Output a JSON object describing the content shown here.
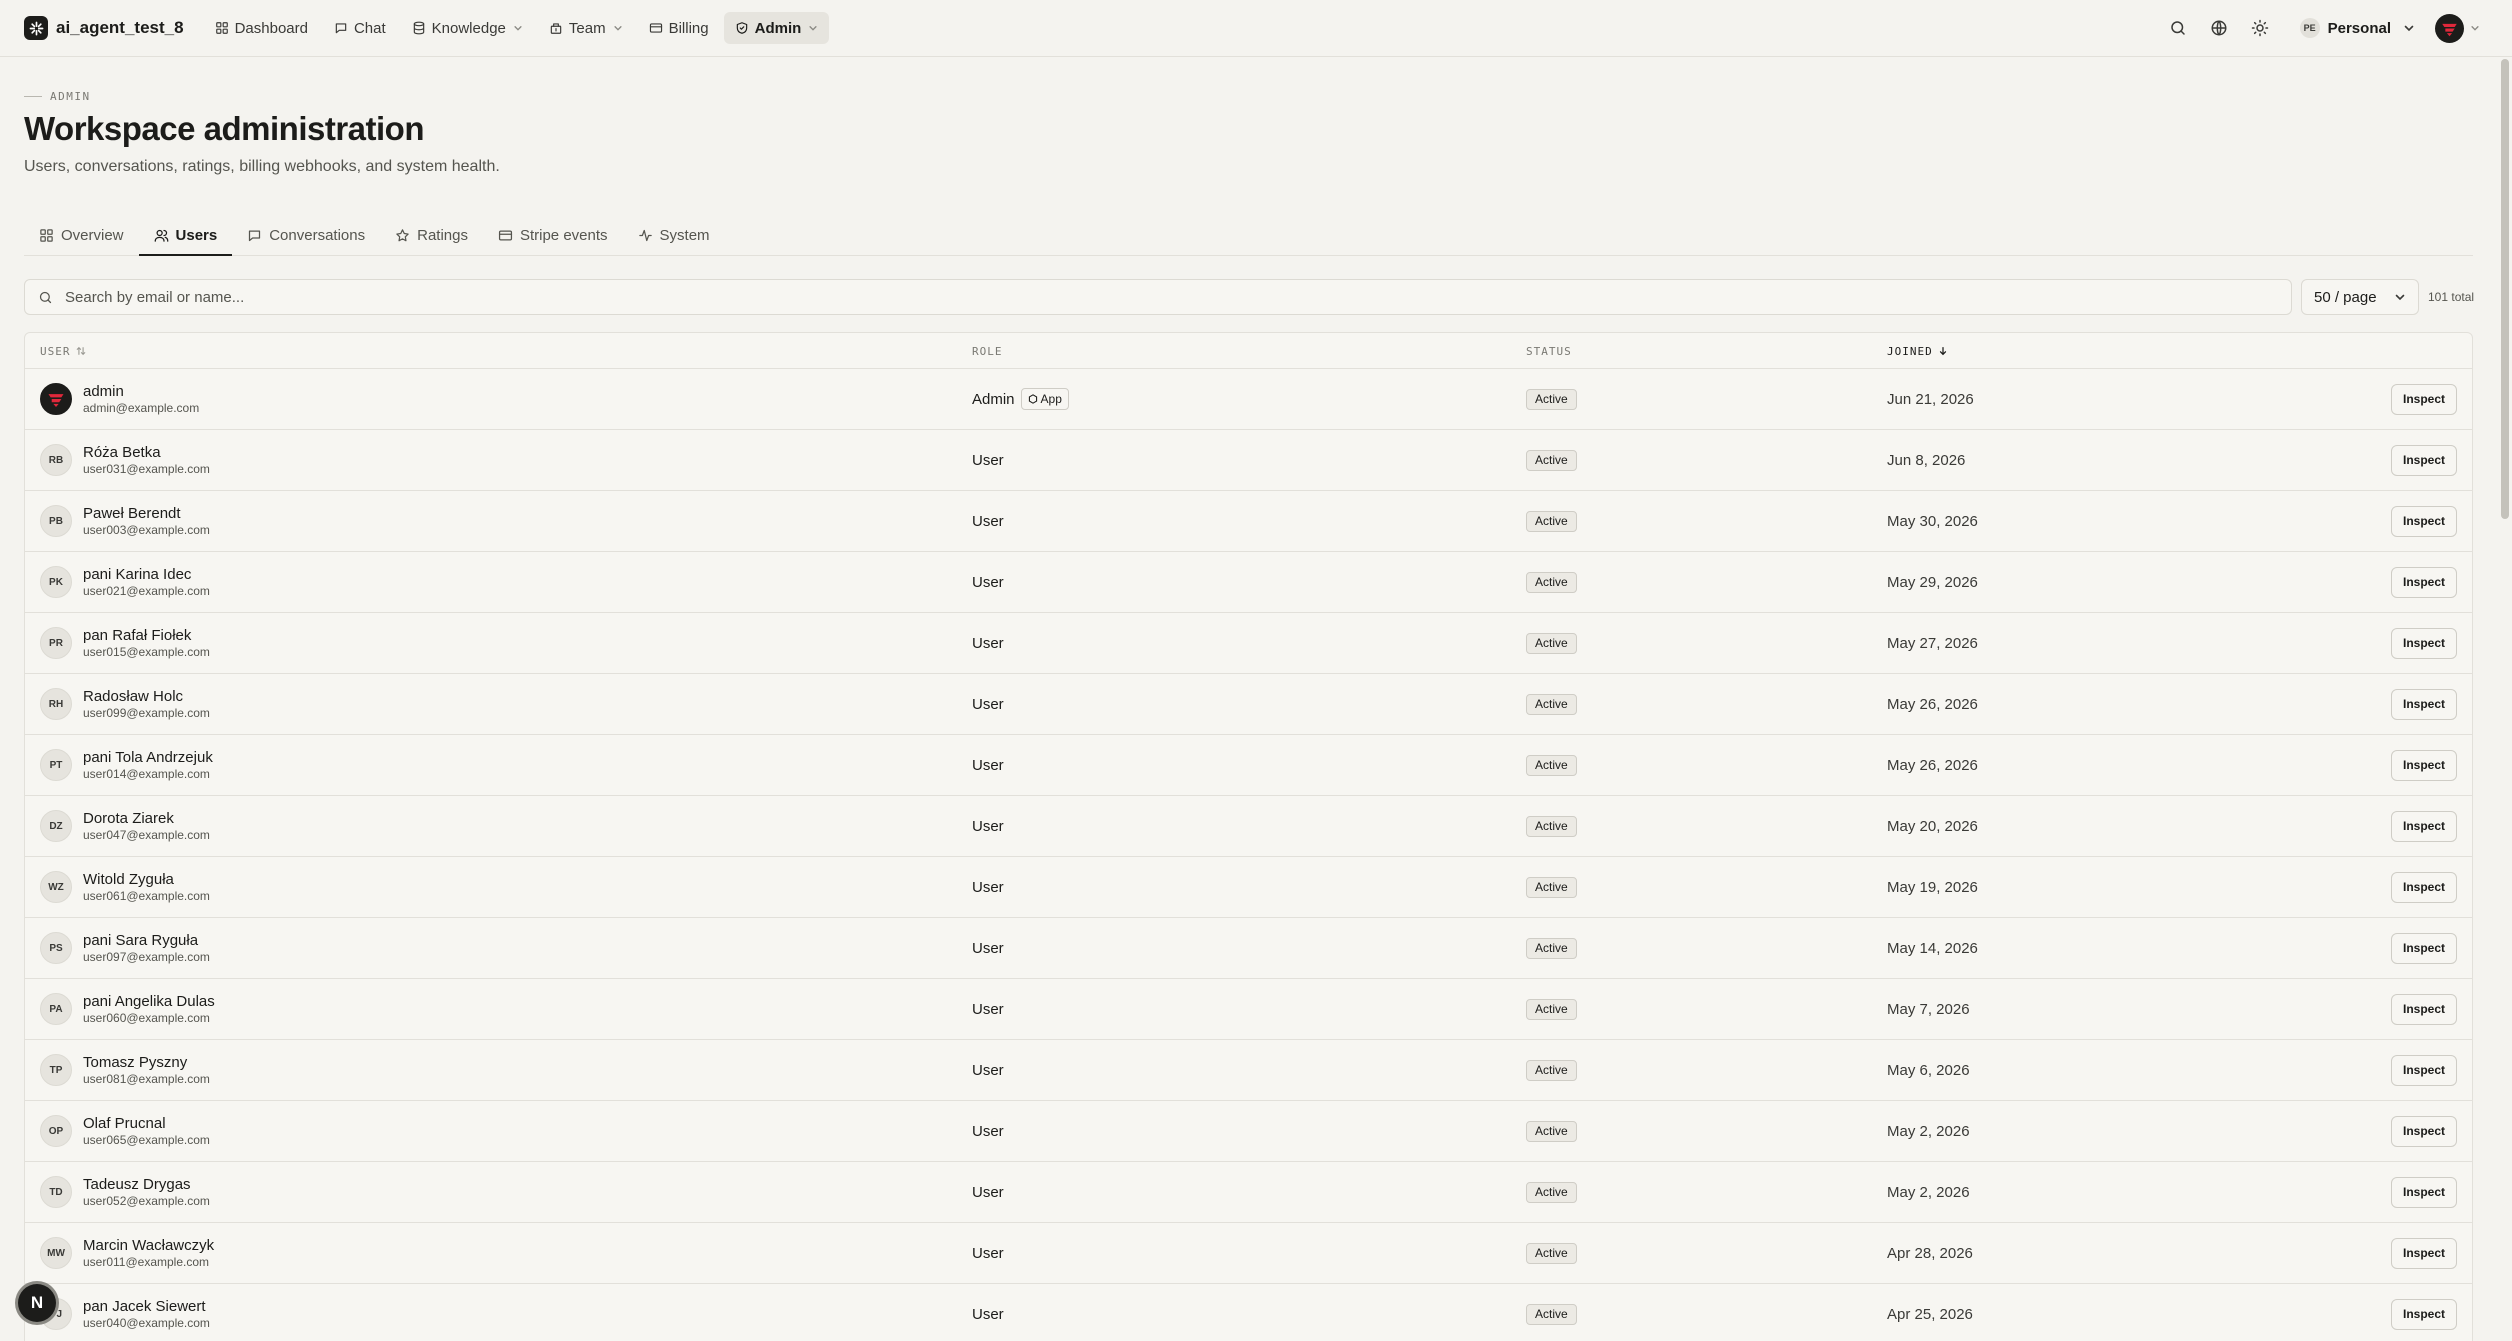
{
  "app": {
    "name": "ai_agent_test_8"
  },
  "nav": {
    "items": [
      {
        "label": "Dashboard",
        "icon": "dashboard-icon",
        "has_menu": false,
        "active": false
      },
      {
        "label": "Chat",
        "icon": "chat-icon",
        "has_menu": false,
        "active": false
      },
      {
        "label": "Knowledge",
        "icon": "database-icon",
        "has_menu": true,
        "active": false
      },
      {
        "label": "Team",
        "icon": "team-icon",
        "has_menu": true,
        "active": false
      },
      {
        "label": "Billing",
        "icon": "card-icon",
        "has_menu": false,
        "active": false
      },
      {
        "label": "Admin",
        "icon": "shield-icon",
        "has_menu": true,
        "active": true
      }
    ]
  },
  "topbar": {
    "workspace_initials": "PE",
    "workspace_name": "Personal"
  },
  "header": {
    "eyebrow": "ADMIN",
    "title": "Workspace administration",
    "subtitle": "Users, conversations, ratings, billing webhooks, and system health."
  },
  "tabs": [
    {
      "label": "Overview",
      "icon": "grid-icon",
      "active": false
    },
    {
      "label": "Users",
      "icon": "users-icon",
      "active": true
    },
    {
      "label": "Conversations",
      "icon": "chat-icon",
      "active": false
    },
    {
      "label": "Ratings",
      "icon": "star-icon",
      "active": false
    },
    {
      "label": "Stripe events",
      "icon": "card-icon",
      "active": false
    },
    {
      "label": "System",
      "icon": "activity-icon",
      "active": false
    }
  ],
  "toolbar": {
    "search_placeholder": "Search by email or name...",
    "per_page": "50 / page",
    "total": "101 total"
  },
  "table": {
    "columns": {
      "user": "USER",
      "role": "ROLE",
      "status": "STATUS",
      "joined": "JOINED"
    },
    "action_label": "Inspect",
    "rows": [
      {
        "initials": "",
        "avatar_image": true,
        "name": "admin",
        "email": "admin@example.com",
        "role": "Admin",
        "role_tag": "App",
        "status": "Active",
        "joined": "Jun 21, 2026"
      },
      {
        "initials": "RB",
        "name": "Róża Betka",
        "email": "user031@example.com",
        "role": "User",
        "status": "Active",
        "joined": "Jun 8, 2026"
      },
      {
        "initials": "PB",
        "name": "Paweł Berendt",
        "email": "user003@example.com",
        "role": "User",
        "status": "Active",
        "joined": "May 30, 2026"
      },
      {
        "initials": "PK",
        "name": "pani Karina Idec",
        "email": "user021@example.com",
        "role": "User",
        "status": "Active",
        "joined": "May 29, 2026"
      },
      {
        "initials": "PR",
        "name": "pan Rafał Fiołek",
        "email": "user015@example.com",
        "role": "User",
        "status": "Active",
        "joined": "May 27, 2026"
      },
      {
        "initials": "RH",
        "name": "Radosław Holc",
        "email": "user099@example.com",
        "role": "User",
        "status": "Active",
        "joined": "May 26, 2026"
      },
      {
        "initials": "PT",
        "name": "pani Tola Andrzejuk",
        "email": "user014@example.com",
        "role": "User",
        "status": "Active",
        "joined": "May 26, 2026"
      },
      {
        "initials": "DZ",
        "name": "Dorota Ziarek",
        "email": "user047@example.com",
        "role": "User",
        "status": "Active",
        "joined": "May 20, 2026"
      },
      {
        "initials": "WZ",
        "name": "Witold Zyguła",
        "email": "user061@example.com",
        "role": "User",
        "status": "Active",
        "joined": "May 19, 2026"
      },
      {
        "initials": "PS",
        "name": "pani Sara Ryguła",
        "email": "user097@example.com",
        "role": "User",
        "status": "Active",
        "joined": "May 14, 2026"
      },
      {
        "initials": "PA",
        "name": "pani Angelika Dulas",
        "email": "user060@example.com",
        "role": "User",
        "status": "Active",
        "joined": "May 7, 2026"
      },
      {
        "initials": "TP",
        "name": "Tomasz Pyszny",
        "email": "user081@example.com",
        "role": "User",
        "status": "Active",
        "joined": "May 6, 2026"
      },
      {
        "initials": "OP",
        "name": "Olaf Prucnal",
        "email": "user065@example.com",
        "role": "User",
        "status": "Active",
        "joined": "May 2, 2026"
      },
      {
        "initials": "TD",
        "name": "Tadeusz Drygas",
        "email": "user052@example.com",
        "role": "User",
        "status": "Active",
        "joined": "May 2, 2026"
      },
      {
        "initials": "MW",
        "name": "Marcin Wacławczyk",
        "email": "user011@example.com",
        "role": "User",
        "status": "Active",
        "joined": "Apr 28, 2026"
      },
      {
        "initials": "PJ",
        "name": "pan Jacek Siewert",
        "email": "user040@example.com",
        "role": "User",
        "status": "Active",
        "joined": "Apr 25, 2026"
      }
    ]
  },
  "fab": {
    "label": "N"
  },
  "colors": {
    "background": "#f4f3ef",
    "text": "#1c1c1a",
    "brand_red": "#e0283b",
    "border": "#e2e0da"
  }
}
